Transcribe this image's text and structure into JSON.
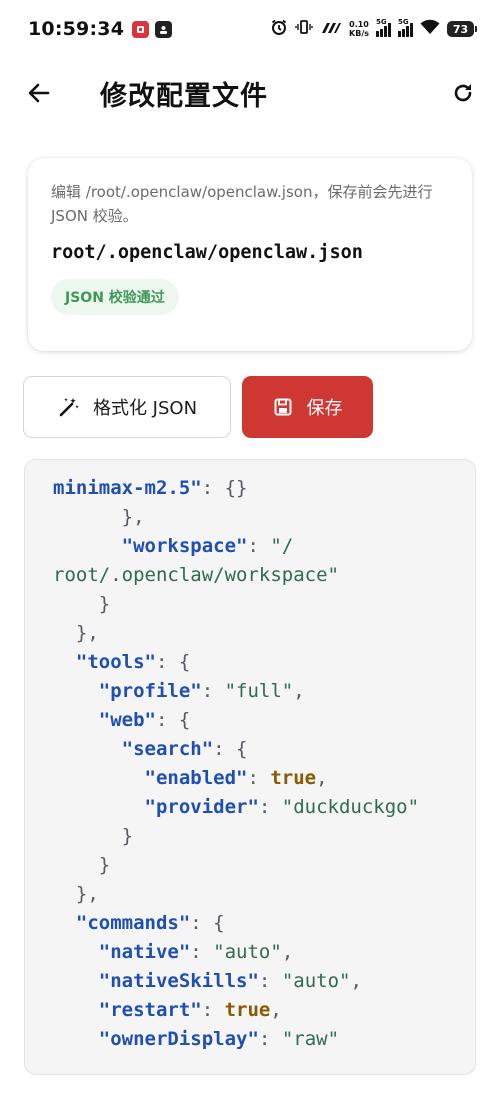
{
  "status_bar": {
    "time": "10:59:34",
    "net_speed_value": "0.10",
    "net_speed_unit": "KB/s",
    "sim1_label": "5G",
    "sim2_label": "5G",
    "battery": "73"
  },
  "app_bar": {
    "title": "修改配置文件",
    "back_icon": "arrow-left-icon",
    "refresh_icon": "refresh-icon"
  },
  "info_card": {
    "description": "编辑 /root/.openclaw/openclaw.json，保存前会先进行 JSON 校验。",
    "path": "root/.openclaw/openclaw.json",
    "validation_status": "JSON 校验通过"
  },
  "actions": {
    "format_label": "格式化 JSON",
    "format_icon": "magic-wand-icon",
    "save_label": "保存",
    "save_icon": "floppy-disk-icon"
  },
  "colors": {
    "accent": "#cf3832",
    "success": "#3d9a55",
    "json_key": "#1f4fb5",
    "json_string": "#2f6b4f"
  },
  "editor": {
    "lines": [
      [
        {
          "t": "key",
          "v": "minimax-m2.5\""
        },
        {
          "t": "punct",
          "v": ": {}"
        }
      ],
      [
        {
          "t": "punct",
          "v": "      },"
        }
      ],
      [
        {
          "t": "punct",
          "v": "      "
        },
        {
          "t": "key",
          "v": "\"workspace\""
        },
        {
          "t": "punct",
          "v": ": "
        },
        {
          "t": "str",
          "v": "\"/"
        }
      ],
      [
        {
          "t": "str",
          "v": "root/.openclaw/workspace\""
        }
      ],
      [
        {
          "t": "punct",
          "v": "    }"
        }
      ],
      [
        {
          "t": "punct",
          "v": "  },"
        }
      ],
      [
        {
          "t": "punct",
          "v": "  "
        },
        {
          "t": "key",
          "v": "\"tools\""
        },
        {
          "t": "punct",
          "v": ": {"
        }
      ],
      [
        {
          "t": "punct",
          "v": "    "
        },
        {
          "t": "key",
          "v": "\"profile\""
        },
        {
          "t": "punct",
          "v": ": "
        },
        {
          "t": "str",
          "v": "\"full\""
        },
        {
          "t": "punct",
          "v": ","
        }
      ],
      [
        {
          "t": "punct",
          "v": "    "
        },
        {
          "t": "key",
          "v": "\"web\""
        },
        {
          "t": "punct",
          "v": ": {"
        }
      ],
      [
        {
          "t": "punct",
          "v": "      "
        },
        {
          "t": "key",
          "v": "\"search\""
        },
        {
          "t": "punct",
          "v": ": {"
        }
      ],
      [
        {
          "t": "punct",
          "v": "        "
        },
        {
          "t": "key",
          "v": "\"enabled\""
        },
        {
          "t": "punct",
          "v": ": "
        },
        {
          "t": "bool",
          "v": "true"
        },
        {
          "t": "punct",
          "v": ","
        }
      ],
      [
        {
          "t": "punct",
          "v": "        "
        },
        {
          "t": "key",
          "v": "\"provider\""
        },
        {
          "t": "punct",
          "v": ": "
        },
        {
          "t": "str",
          "v": "\"duckduckgo\""
        }
      ],
      [
        {
          "t": "punct",
          "v": "      }"
        }
      ],
      [
        {
          "t": "punct",
          "v": "    }"
        }
      ],
      [
        {
          "t": "punct",
          "v": "  },"
        }
      ],
      [
        {
          "t": "punct",
          "v": "  "
        },
        {
          "t": "key",
          "v": "\"commands\""
        },
        {
          "t": "punct",
          "v": ": {"
        }
      ],
      [
        {
          "t": "punct",
          "v": "    "
        },
        {
          "t": "key",
          "v": "\"native\""
        },
        {
          "t": "punct",
          "v": ": "
        },
        {
          "t": "str",
          "v": "\"auto\""
        },
        {
          "t": "punct",
          "v": ","
        }
      ],
      [
        {
          "t": "punct",
          "v": "    "
        },
        {
          "t": "key",
          "v": "\"nativeSkills\""
        },
        {
          "t": "punct",
          "v": ": "
        },
        {
          "t": "str",
          "v": "\"auto\""
        },
        {
          "t": "punct",
          "v": ","
        }
      ],
      [
        {
          "t": "punct",
          "v": "    "
        },
        {
          "t": "key",
          "v": "\"restart\""
        },
        {
          "t": "punct",
          "v": ": "
        },
        {
          "t": "bool",
          "v": "true"
        },
        {
          "t": "punct",
          "v": ","
        }
      ],
      [
        {
          "t": "punct",
          "v": "    "
        },
        {
          "t": "key",
          "v": "\"ownerDisplay\""
        },
        {
          "t": "punct",
          "v": ": "
        },
        {
          "t": "str",
          "v": "\"raw\""
        }
      ]
    ]
  }
}
